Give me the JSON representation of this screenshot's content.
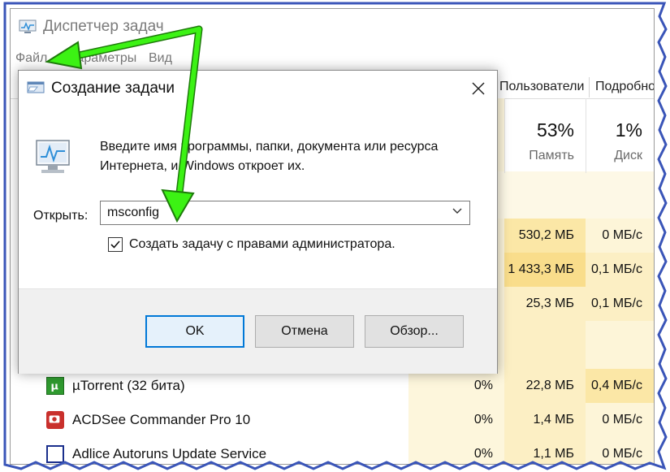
{
  "taskmanager": {
    "title": "Диспетчер задач",
    "menu": [
      "Файл",
      "Параметры",
      "Вид"
    ],
    "tabs": [
      "Пользователи",
      "Подробности"
    ],
    "columns": [
      {
        "percent": "53%",
        "label": "Память"
      },
      {
        "percent": "1%",
        "label": "Диск"
      }
    ],
    "rows": [
      {
        "name": "",
        "cpu": "",
        "memory": "530,2 МБ",
        "disk": "0 МБ/с"
      },
      {
        "name": "",
        "cpu": "",
        "memory": "1 433,3 МБ",
        "disk": "0,1 МБ/с"
      },
      {
        "name": "",
        "cpu": "",
        "memory": "25,3 МБ",
        "disk": "0,1 МБ/с"
      },
      {
        "name": "µTorrent (32 бита)",
        "cpu": "0%",
        "memory": "22,8 МБ",
        "disk": "0,4 МБ/с"
      },
      {
        "name": "ACDSee Commander Pro 10",
        "cpu": "0%",
        "memory": "1,4 МБ",
        "disk": "0 МБ/с"
      },
      {
        "name": "Adlice Autoruns Update Service",
        "cpu": "0%",
        "memory": "1,1 МБ",
        "disk": "0 МБ/с"
      }
    ],
    "colors": {
      "memory_high": "#fbe7a6",
      "memory_mid": "#fcefc4",
      "memory_low": "#fdf5d8",
      "memory_hot": "#f9dd8b"
    }
  },
  "dialog": {
    "title": "Создание задачи",
    "description": "Введите имя программы, папки, документа или ресурса Интернета, и Windows откроет их.",
    "open_label": "Открыть:",
    "open_value": "msconfig",
    "admin_label": "Создать задачу с правами администратора.",
    "admin_checked": true,
    "buttons": {
      "ok": "OK",
      "cancel": "Отмена",
      "browse": "Обзор..."
    },
    "accent": "#0078d7"
  },
  "annotations": {
    "arrow_color": "#3cf214"
  }
}
